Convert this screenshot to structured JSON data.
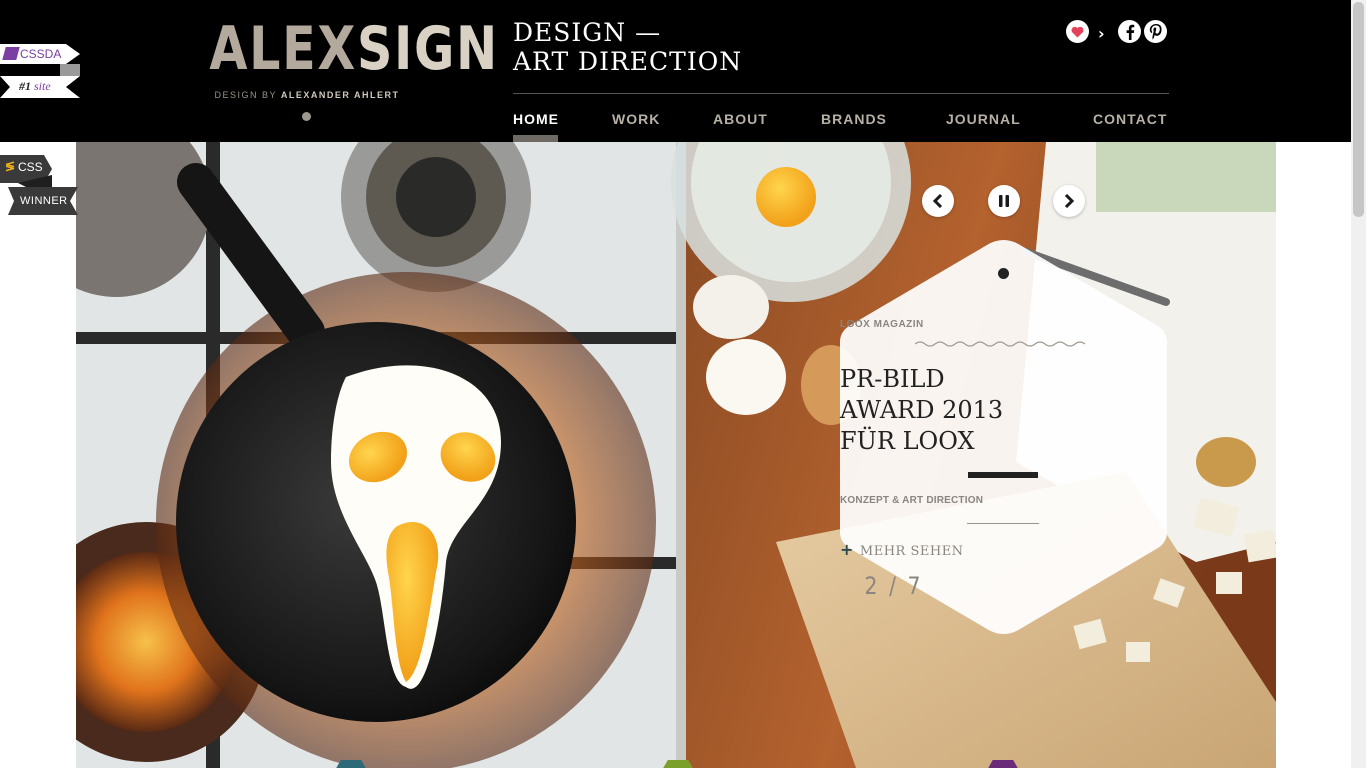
{
  "badges": {
    "cssda_label": "CSSDA",
    "cssda_rank": "#1",
    "cssda_rank_suffix": "site",
    "css_label": "CSS",
    "winner_label": "WINNER"
  },
  "header": {
    "logo_part1": "ALEX",
    "logo_part2": "SIGN",
    "logo_sub_prefix": "DESIGN BY",
    "logo_sub_name": "ALEXANDER AHLERT",
    "tagline_line1": "DESIGN —",
    "tagline_line2": "ART DIRECTION"
  },
  "nav": {
    "items": [
      {
        "label": "HOME",
        "active": true
      },
      {
        "label": "WORK"
      },
      {
        "label": "ABOUT"
      },
      {
        "label": "BRANDS"
      },
      {
        "label": "JOURNAL"
      },
      {
        "label": "CONTACT"
      }
    ]
  },
  "social": {
    "icons": [
      "heart-icon",
      "chevron-right-icon",
      "facebook-icon",
      "pinterest-icon"
    ],
    "heart_color": "#e2425a"
  },
  "slider": {
    "kicker": "LOOX MAGAZIN",
    "title_line1": "PR-BILD",
    "title_line2": "AWARD 2013",
    "title_line3": "FÜR LOOX",
    "subtitle": "KONZEPT & ART DIRECTION",
    "more_label": "MEHR SEHEN",
    "counter": "2 / 7",
    "controls": [
      "prev-icon",
      "pause-icon",
      "next-icon"
    ]
  },
  "colors": {
    "header_bg": "#000000",
    "logo": "#b3aa9d",
    "nav_text": "#b6b0a5",
    "nav_active": "#ffffff",
    "cssda_purple": "#7a3fa0"
  }
}
